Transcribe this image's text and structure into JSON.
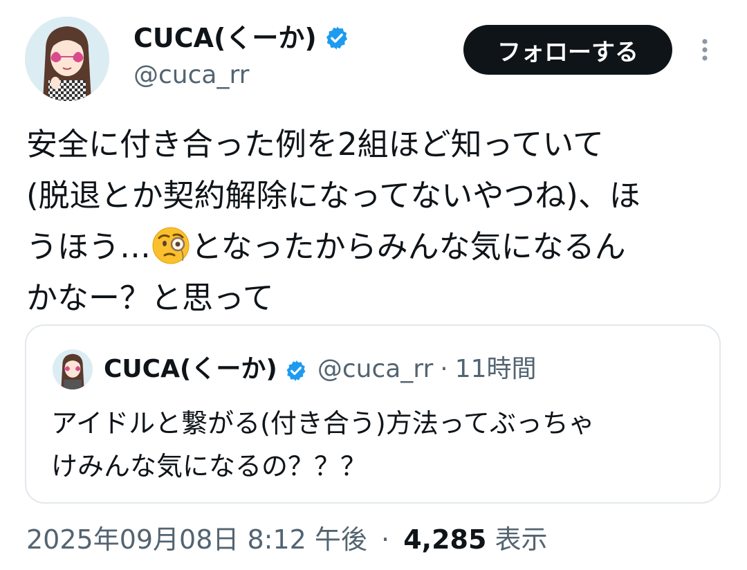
{
  "author": {
    "display_name": "CUCA(くーか)",
    "handle": "@cuca_rr",
    "avatar_icon": "avatar-girl-heart-sunglasses",
    "verified_icon": "verified-badge-icon",
    "verified_color": "#1d9bf0"
  },
  "actions": {
    "follow_label": "フォローする",
    "more_icon": "more-vertical-icon"
  },
  "tweet": {
    "text_part1": "安全に付き合った例を2組ほど知っていて\n(脱退とか契約解除になってないやつね)、ほ\nうほう…",
    "emoji": "face-with-monocle-emoji",
    "text_part2": "となったからみんな気になるん\nかなー？と思って"
  },
  "quoted_tweet": {
    "display_name": "CUCA(くーか)",
    "handle": "@cuca_rr",
    "separator": "·",
    "time_ago": "11時間",
    "text": "アイドルと繋がる(付き合う)方法ってぶっちゃ\nけみんな気になるの？？？"
  },
  "footer": {
    "timestamp": "2025年09月08日 8:12 午後",
    "separator": "·",
    "views_count": "4,285",
    "views_label": "表示"
  },
  "colors": {
    "text": "#0f1419",
    "secondary": "#536471",
    "border": "#e1e8ed",
    "button_bg": "#0f1419"
  }
}
